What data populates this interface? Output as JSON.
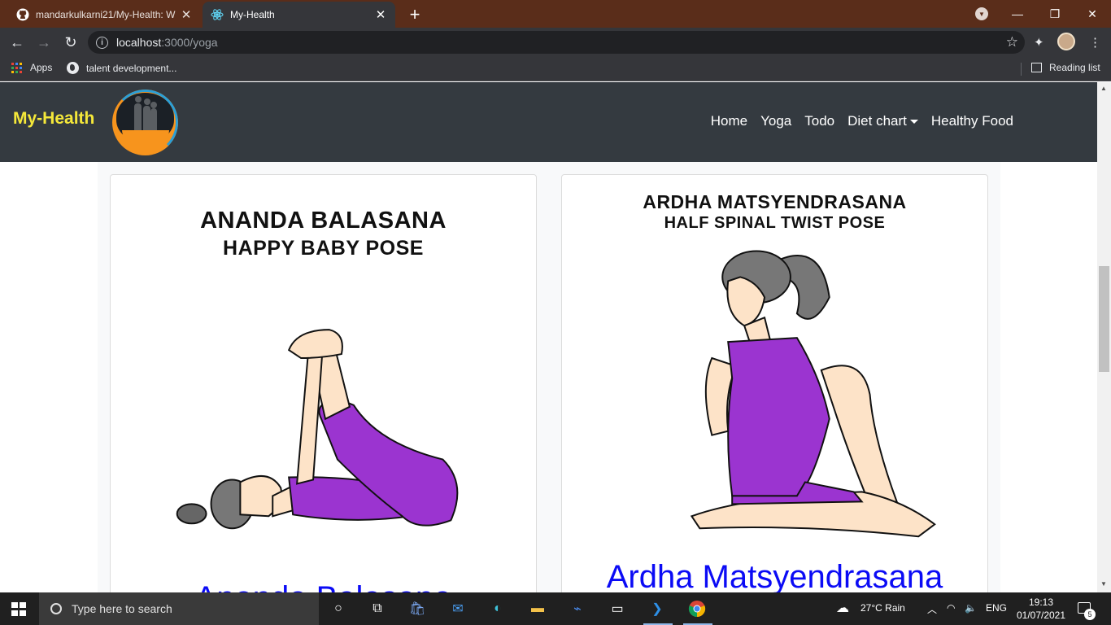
{
  "browser": {
    "tabs": [
      {
        "title": "mandarkulkarni21/My-Health: W",
        "icon": "github-icon",
        "active": false
      },
      {
        "title": "My-Health",
        "icon": "react-icon",
        "active": true
      }
    ],
    "url_host": "localhost",
    "url_path": ":3000/yoga",
    "bookmarks": [
      {
        "label": "Apps",
        "icon": "apps-grid-icon"
      },
      {
        "label": "talent development...",
        "icon": "globe-icon"
      }
    ],
    "reading_list": "Reading list"
  },
  "navbar": {
    "brand": "My-Health",
    "links": [
      "Home",
      "Yoga",
      "Todo",
      "Diet chart",
      "Healthy Food"
    ]
  },
  "cards": [
    {
      "poster_title": "ANANDA BALASANA",
      "poster_subtitle": "HAPPY BABY POSE",
      "title": "Ananda Balasana"
    },
    {
      "poster_title": "ARDHA MATSYENDRASANA",
      "poster_subtitle": "HALF SPINAL TWIST POSE",
      "title": "Ardha Matsyendrasana"
    }
  ],
  "taskbar": {
    "search_placeholder": "Type here to search",
    "weather": "27°C  Rain",
    "language": "ENG",
    "time": "19:13",
    "date": "01/07/2021",
    "notifications": "5"
  },
  "colors": {
    "brand_yellow": "#f5e83a",
    "navbar_bg": "#343a40",
    "card_title_blue": "#0b0bf5",
    "tab_strip": "#5a2d1a",
    "outfit_purple": "#9b34d0"
  }
}
